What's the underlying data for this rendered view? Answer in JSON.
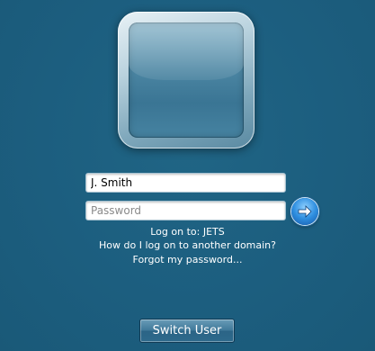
{
  "login": {
    "username_value": "J. Smith",
    "password_placeholder": "Password",
    "go_icon": "arrow-right-icon",
    "logon_to": "Log on to: JETS",
    "other_domain_link": "How do I log on to another domain?",
    "forgot_password_link": "Forgot my password...",
    "switch_user_label": "Switch User"
  },
  "colors": {
    "background": "#1d5f82",
    "accent": "#2f8fe0",
    "text": "#ffffff"
  }
}
